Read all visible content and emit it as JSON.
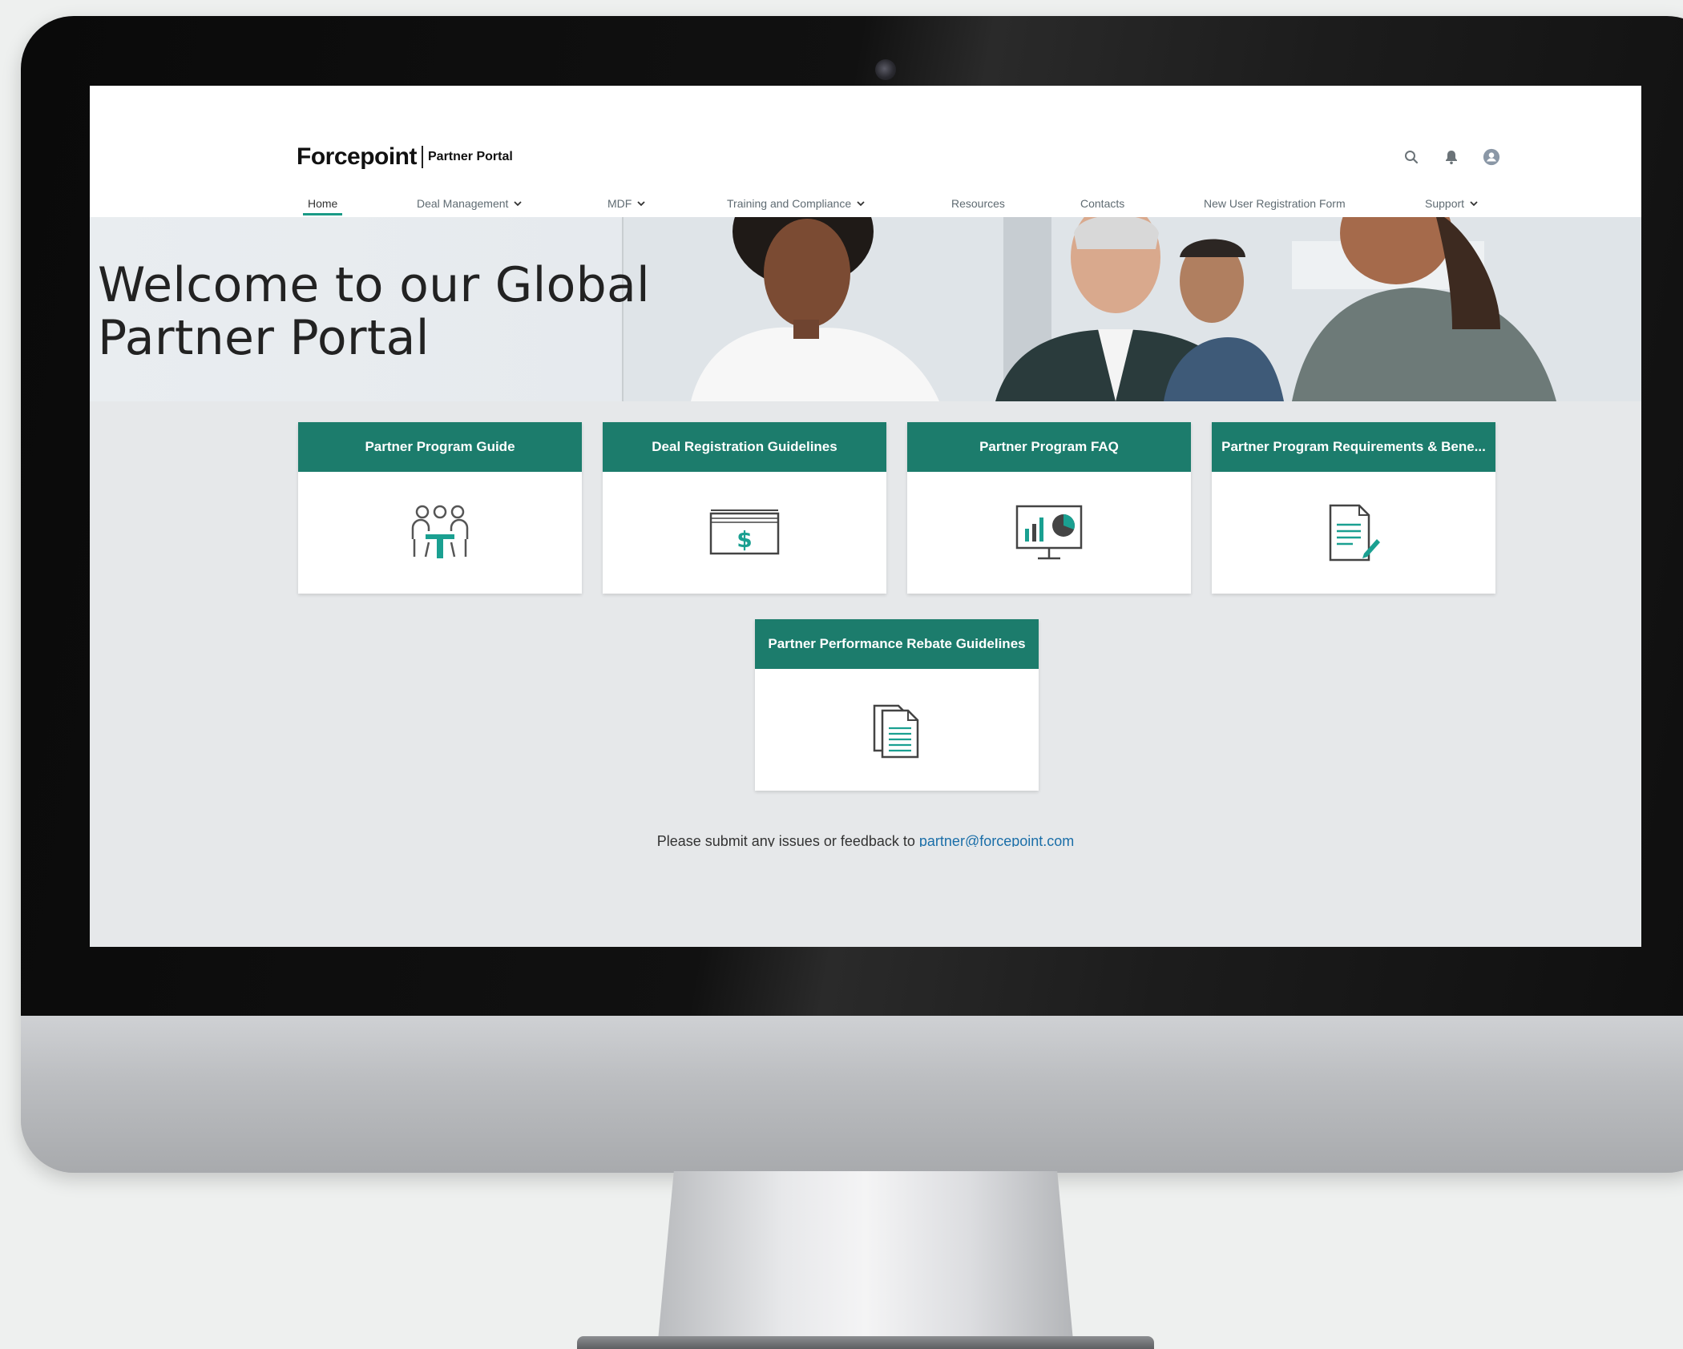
{
  "brand": {
    "logo_text": "Forcepoint",
    "logo_subtext": "Partner Portal"
  },
  "header_icons": [
    "search-icon",
    "bell-icon",
    "user-avatar-icon"
  ],
  "nav": {
    "items": [
      {
        "label": "Home",
        "active": true,
        "dropdown": false
      },
      {
        "label": "Deal Management",
        "active": false,
        "dropdown": true
      },
      {
        "label": "MDF",
        "active": false,
        "dropdown": true
      },
      {
        "label": "Training and Compliance",
        "active": false,
        "dropdown": true
      },
      {
        "label": "Resources",
        "active": false,
        "dropdown": false
      },
      {
        "label": "Contacts",
        "active": false,
        "dropdown": false
      },
      {
        "label": "New User Registration Form",
        "active": false,
        "dropdown": false
      },
      {
        "label": "Support",
        "active": false,
        "dropdown": true
      }
    ]
  },
  "hero": {
    "line1": "Welcome to our Global",
    "line2": "Partner Portal"
  },
  "tiles": [
    {
      "title": "Partner Program Guide",
      "icon": "meeting-people-icon"
    },
    {
      "title": "Deal Registration Guidelines",
      "icon": "dollar-bill-icon"
    },
    {
      "title": "Partner Program FAQ",
      "icon": "presentation-chart-icon"
    },
    {
      "title": "Partner Program Requirements & Bene...",
      "icon": "document-edit-icon"
    },
    {
      "title": "Partner Performance Rebate Guidelines",
      "icon": "documents-icon"
    }
  ],
  "footer": {
    "text": "Please submit any issues or feedback to ",
    "email": "partner@forcepoint.com"
  },
  "colors": {
    "accent": "#1c7c6c",
    "nav_underline": "#1a9a86",
    "link": "#1a6ea8"
  }
}
